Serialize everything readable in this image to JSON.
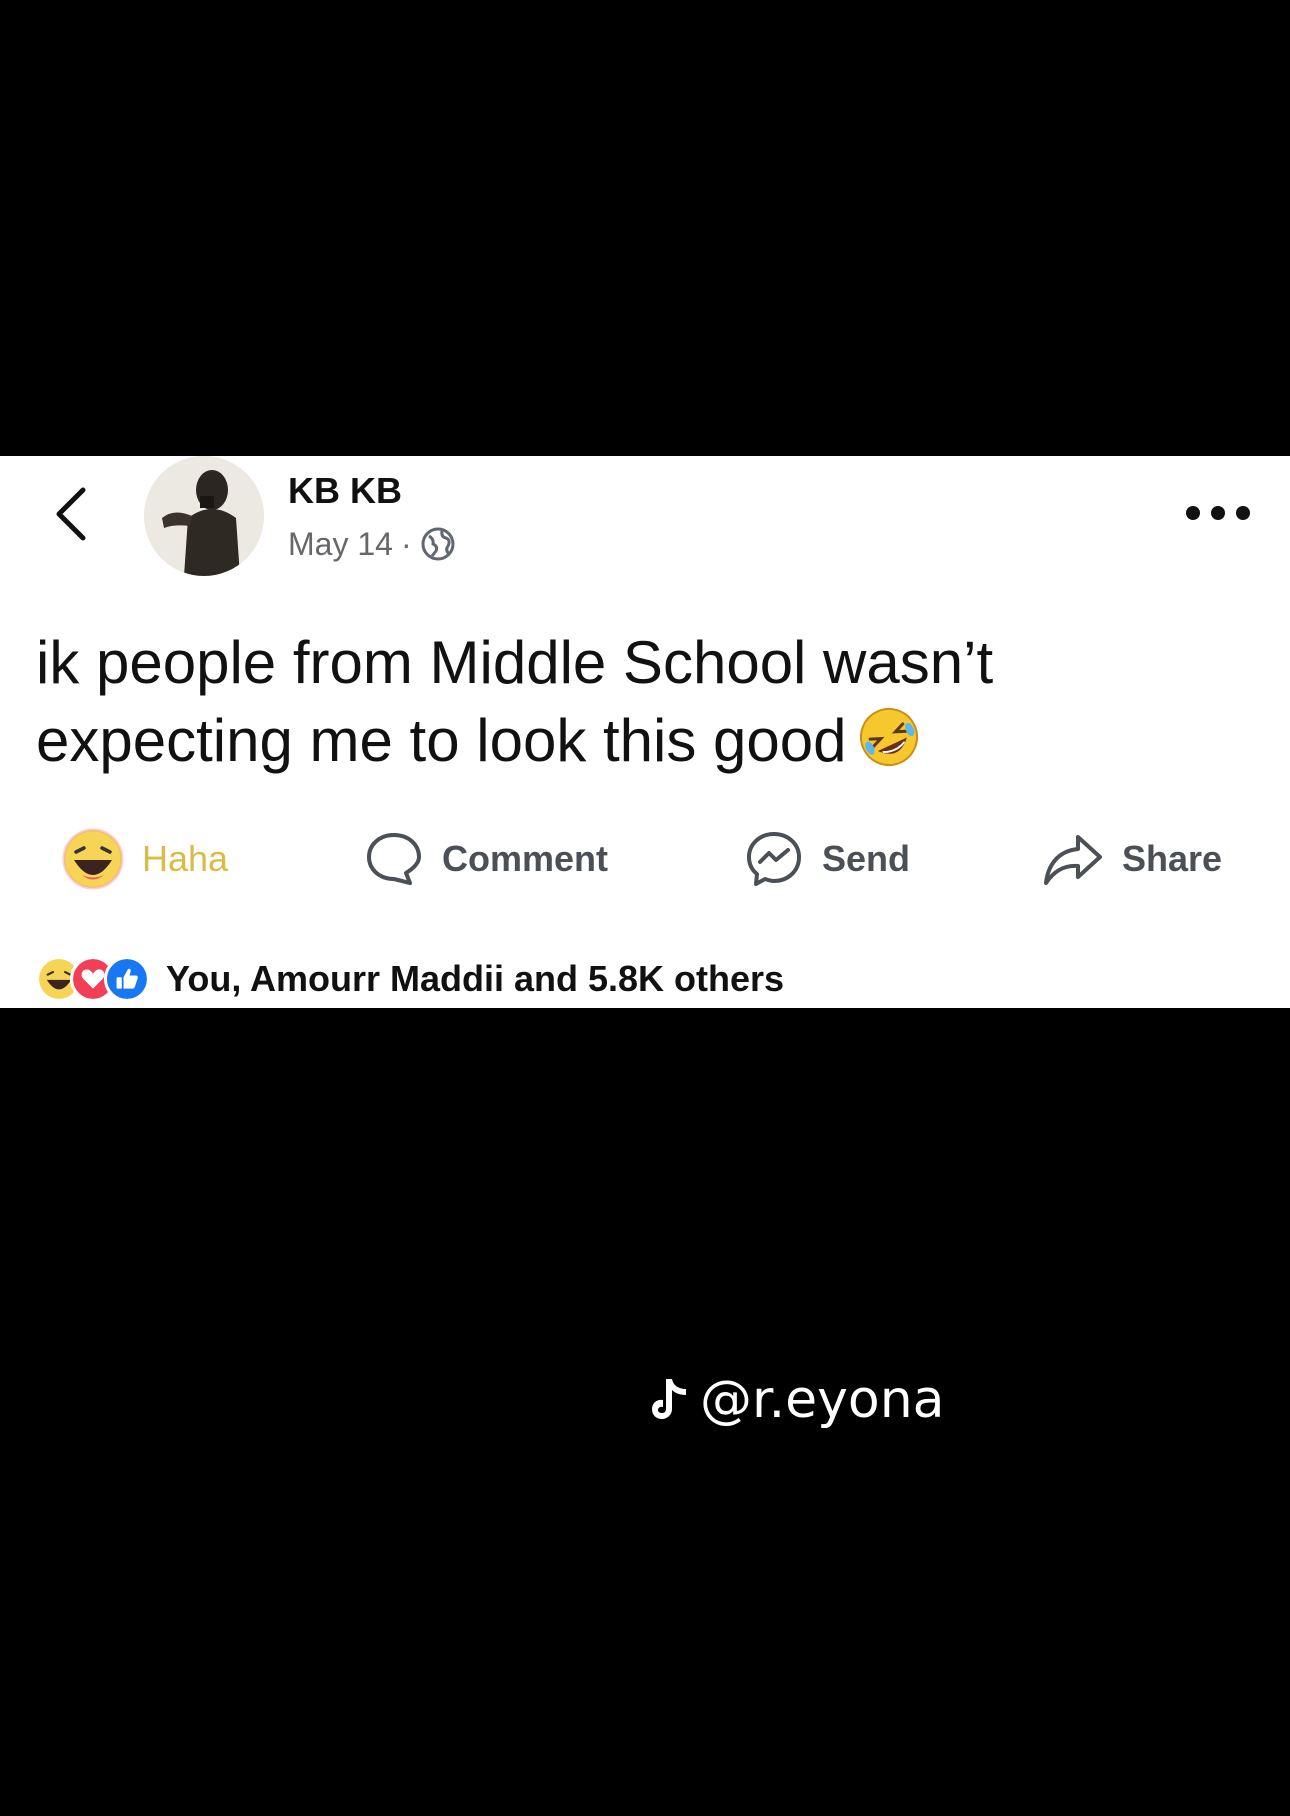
{
  "post": {
    "author_name": "KB KB",
    "date": "May 14",
    "separator": "·",
    "privacy_icon": "globe-icon",
    "text": "ik people from Middle School wasn’t expecting me to look this good",
    "text_emoji": "rolling-on-floor-laughing-emoji"
  },
  "actions": {
    "haha": "Haha",
    "comment": "Comment",
    "send": "Send",
    "share": "Share"
  },
  "reactions": {
    "icons": [
      "haha-icon",
      "love-icon",
      "like-icon"
    ],
    "summary": "You, Amourr Maddii and 5.8K others"
  },
  "watermark": {
    "handle": "@r.eyona",
    "icon": "tiktok-icon"
  },
  "colors": {
    "background": "#000000",
    "card": "#ffffff",
    "haha_text": "#d9bb45",
    "like_blue": "#1877f2",
    "love_red": "#f33e58"
  }
}
